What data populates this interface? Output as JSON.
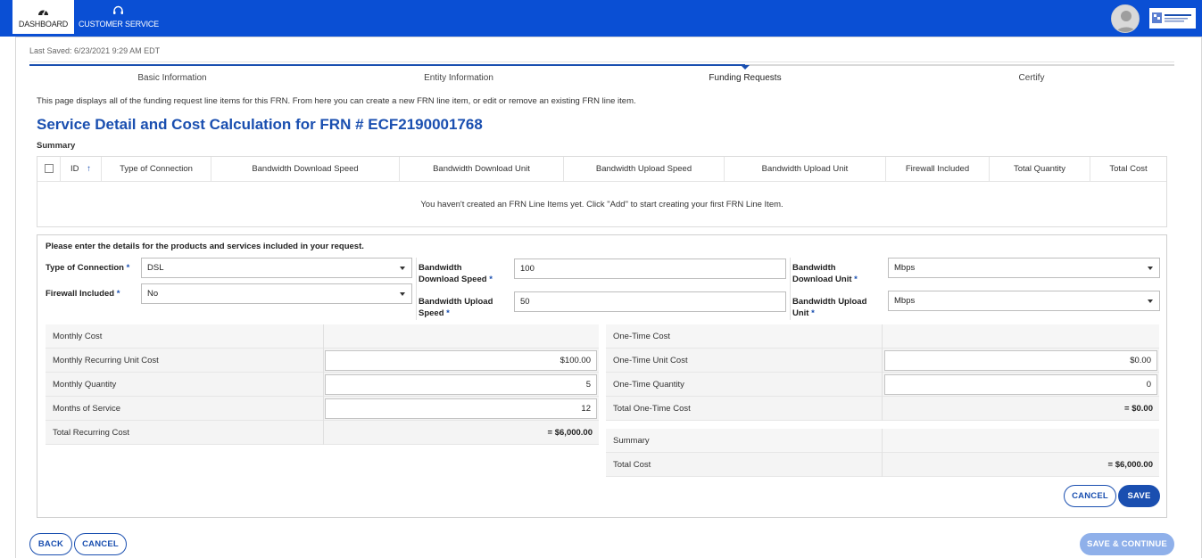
{
  "topnav": {
    "dashboard_label": "DASHBOARD",
    "customer_service_label": "CUSTOMER SERVICE"
  },
  "last_saved": "Last Saved: 6/23/2021 9:29 AM EDT",
  "steps": [
    {
      "label": "Basic Information"
    },
    {
      "label": "Entity Information"
    },
    {
      "label": "Funding Requests"
    },
    {
      "label": "Certify"
    }
  ],
  "active_step_index": 2,
  "description": "This page displays all of the funding request line items for this FRN. From here you can create a new FRN line item, or edit or remove an existing FRN line item.",
  "page_title": "Service Detail and Cost Calculation for FRN # ECF2190001768",
  "summary_label": "Summary",
  "table": {
    "id_header": "ID",
    "columns": [
      "Type of Connection",
      "Bandwidth Download Speed",
      "Bandwidth Download Unit",
      "Bandwidth Upload Speed",
      "Bandwidth Upload Unit",
      "Firewall Included",
      "Total Quantity",
      "Total Cost"
    ],
    "empty_message": "You haven't created an FRN Line Items yet. Click \"Add\" to start creating your first FRN Line Item."
  },
  "form": {
    "intro": "Please enter the details for the products and services included in your request.",
    "required_marker": "*",
    "type_of_connection": {
      "label": "Type of Connection",
      "value": "DSL"
    },
    "firewall_included": {
      "label": "Firewall Included",
      "value": "No"
    },
    "bw_download_speed": {
      "label_1": "Bandwidth",
      "label_2": "Download Speed",
      "value": "100"
    },
    "bw_upload_speed": {
      "label_1": "Bandwidth Upload",
      "label_2": "Speed",
      "value": "50"
    },
    "bw_download_unit": {
      "label_1": "Bandwidth",
      "label_2": "Download Unit",
      "value": "Mbps"
    },
    "bw_upload_unit": {
      "label_1": "Bandwidth Upload",
      "label_2": "Unit",
      "value": "Mbps"
    }
  },
  "monthly": {
    "header": "Monthly Cost",
    "unit_cost_label": "Monthly Recurring Unit Cost",
    "unit_cost_value": "$100.00",
    "quantity_label": "Monthly Quantity",
    "quantity_value": "5",
    "months_label": "Months of Service",
    "months_value": "12",
    "total_label": "Total Recurring Cost",
    "total_value": "= $6,000.00"
  },
  "onetime": {
    "header": "One-Time Cost",
    "unit_cost_label": "One-Time Unit Cost",
    "unit_cost_value": "$0.00",
    "quantity_label": "One-Time Quantity",
    "quantity_value": "0",
    "total_label": "Total One-Time Cost",
    "total_value": "= $0.00"
  },
  "summary_box": {
    "header": "Summary",
    "total_label": "Total Cost",
    "total_value": "= $6,000.00"
  },
  "buttons": {
    "form_cancel": "CANCEL",
    "form_save": "SAVE",
    "back": "BACK",
    "cancel": "CANCEL",
    "save_continue": "SAVE & CONTINUE"
  },
  "colors": {
    "brand_blue": "#0a4fd4",
    "accent": "#1a4fb0",
    "disabled_button": "#8fb0ea"
  }
}
